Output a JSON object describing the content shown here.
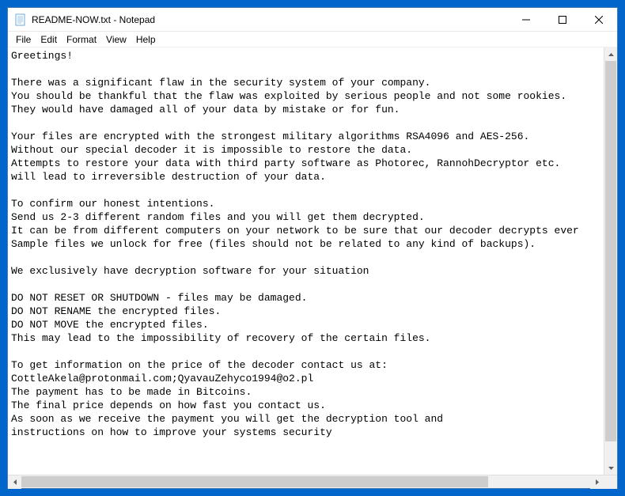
{
  "window": {
    "title": "README-NOW.txt - Notepad"
  },
  "menubar": {
    "items": [
      "File",
      "Edit",
      "Format",
      "View",
      "Help"
    ]
  },
  "document": {
    "text": "Greetings!\n\nThere was a significant flaw in the security system of your company.\nYou should be thankful that the flaw was exploited by serious people and not some rookies.\nThey would have damaged all of your data by mistake or for fun.\n\nYour files are encrypted with the strongest military algorithms RSA4096 and AES-256.\nWithout our special decoder it is impossible to restore the data.\nAttempts to restore your data with third party software as Photorec, RannohDecryptor etc.\nwill lead to irreversible destruction of your data.\n\nTo confirm our honest intentions.\nSend us 2-3 different random files and you will get them decrypted.\nIt can be from different computers on your network to be sure that our decoder decrypts ever\nSample files we unlock for free (files should not be related to any kind of backups).\n\nWe exclusively have decryption software for your situation\n\nDO NOT RESET OR SHUTDOWN - files may be damaged.\nDO NOT RENAME the encrypted files.\nDO NOT MOVE the encrypted files.\nThis may lead to the impossibility of recovery of the certain files.\n\nTo get information on the price of the decoder contact us at:\nCottleAkela@protonmail.com;QyavauZehyco1994@o2.pl\nThe payment has to be made in Bitcoins.\nThe final price depends on how fast you contact us.\nAs soon as we receive the payment you will get the decryption tool and\ninstructions on how to improve your systems security"
  }
}
